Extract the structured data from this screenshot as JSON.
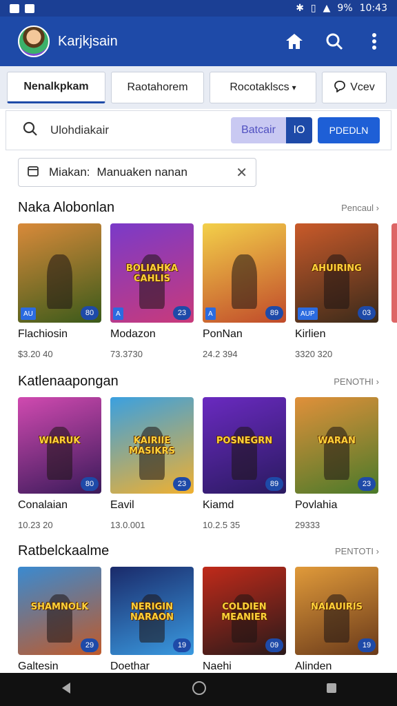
{
  "status_bar": {
    "time": "10:43",
    "battery": "9%"
  },
  "app_bar": {
    "title": "Karjkjsain"
  },
  "tabs": [
    {
      "label": "Nenalkpkam",
      "active": true
    },
    {
      "label": "Raotahorem"
    },
    {
      "label": "Rocotaklscs",
      "has_dropdown": true
    },
    {
      "label": "Vcev",
      "icon": "chat-icon"
    }
  ],
  "search": {
    "text": "Ulohdiakair",
    "batch_label": "Batcair",
    "batch_count": "IO",
    "primary_label": "PDEDLN"
  },
  "filter_chip": {
    "key": "Miakan:",
    "value": "Manuaken nanan"
  },
  "sections": [
    {
      "title": "Naka Alobonlan",
      "see_more": "Pencaul",
      "items": [
        {
          "name": "Flachiosin",
          "sub": "$3.20 40",
          "badge": "80",
          "tag": "AU",
          "thumb_title": "",
          "c1": "#d98a3a",
          "c2": "#3a5a1a"
        },
        {
          "name": "Modazon",
          "sub": "73.3730",
          "badge": "23",
          "tag": "A",
          "thumb_title": "BOLIAHKA CAHLIS",
          "c1": "#7a3ac9",
          "c2": "#c93a7a"
        },
        {
          "name": "PonNan",
          "sub": "24.2 394",
          "badge": "89",
          "tag": "A",
          "thumb_title": "",
          "c1": "#f3d04a",
          "c2": "#c04a2a"
        },
        {
          "name": "Kirlien",
          "sub": "3320 320",
          "badge": "03",
          "tag": "AUP",
          "thumb_title": "AHUIRING",
          "c1": "#c95a2a",
          "c2": "#3a2a1a"
        }
      ]
    },
    {
      "title": "Katlenaapongan",
      "see_more": "PENOTHI",
      "items": [
        {
          "name": "Conalaian",
          "sub": "10.23 20",
          "badge": "80",
          "tag": "",
          "thumb_title": "WIARUK",
          "c1": "#d04ab0",
          "c2": "#3a1a5a"
        },
        {
          "name": "Eavil",
          "sub": "13.0.001",
          "badge": "23",
          "tag": "",
          "thumb_title": "KAIRIIE MASIKRS",
          "c1": "#3aa0e0",
          "c2": "#f0b030"
        },
        {
          "name": "Kiamd",
          "sub": "10.2.5 35",
          "badge": "89",
          "tag": "",
          "thumb_title": "POSNEGRN",
          "c1": "#6a2ac0",
          "c2": "#2a1a60"
        },
        {
          "name": "Povlahia",
          "sub": "29333",
          "badge": "23",
          "tag": "",
          "thumb_title": "WARAN",
          "c1": "#e0903a",
          "c2": "#4a7a2a"
        }
      ]
    },
    {
      "title": "Ratbelckaalme",
      "see_more": "PENTOTI",
      "items": [
        {
          "name": "Galtesin",
          "sub": "",
          "badge": "29",
          "tag": "",
          "thumb_title": "SHAMNOLK",
          "c1": "#3a8ad0",
          "c2": "#c05a2a"
        },
        {
          "name": "Doethar",
          "sub": "",
          "badge": "19",
          "tag": "",
          "thumb_title": "NERIGIN NARAON",
          "c1": "#1a2a6a",
          "c2": "#3a9ae0"
        },
        {
          "name": "Naehi",
          "sub": "",
          "badge": "09",
          "tag": "",
          "thumb_title": "COLDIEN MEANIER",
          "c1": "#c02a1a",
          "c2": "#2a1a1a"
        },
        {
          "name": "Alinden",
          "sub": "",
          "badge": "19",
          "tag": "",
          "thumb_title": "NAIAUIRIS",
          "c1": "#e09a3a",
          "c2": "#6a3a1a"
        }
      ]
    }
  ]
}
